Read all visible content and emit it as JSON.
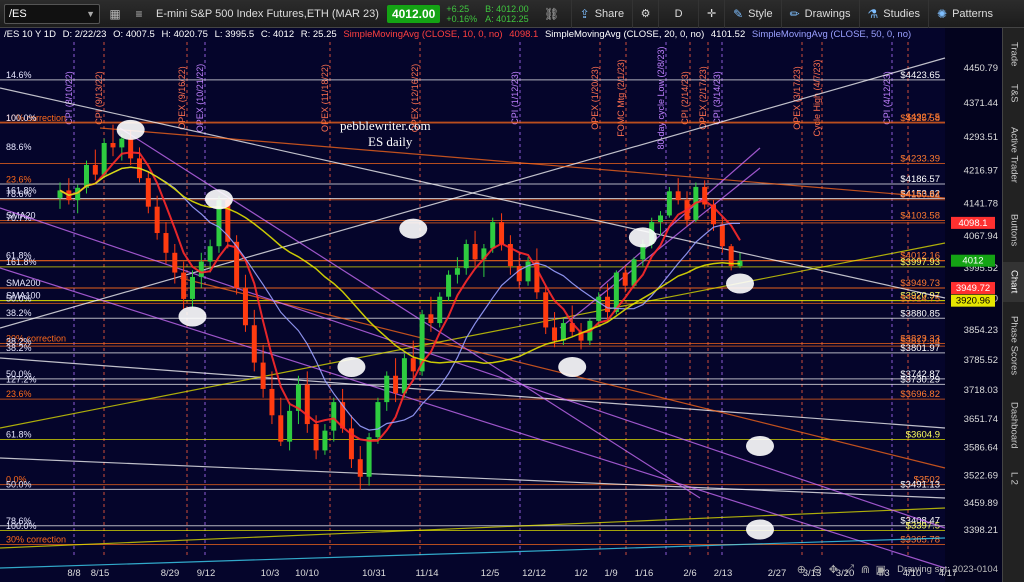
{
  "toolbar": {
    "symbol": "/ES",
    "instrument_name": "E-mini S&P 500 Index Futures,ETH (MAR 23)",
    "last_price": "4012.00",
    "net_change": "+6.25",
    "pct_change": "+0.16%",
    "bid": "B: 4012.00",
    "ask": "A: 4012.25",
    "share_label": "Share",
    "aggregation_label": "D",
    "style_label": "Style",
    "drawings_label": "Drawings",
    "studies_label": "Studies",
    "patterns_label": "Patterns",
    "icons": [
      "chevron-down-icon",
      "grid-icon",
      "menu-icon",
      "link-icon",
      "share-icon",
      "settings-icon",
      "crosshair-icon",
      "pencil-icon",
      "flask-icon",
      "patterns-icon"
    ]
  },
  "studies": {
    "header": "/ES 10 Y 1D",
    "date": "D: 2/22/23",
    "open": "O: 4007.5",
    "high": "H: 4020.75",
    "low": "L: 3995.5",
    "close": "C: 4012",
    "range": "R: 25.25",
    "sma10": "SimpleMovingAvg (CLOSE, 10, 0, no)",
    "sma10_val": "4098.1",
    "sma20": "SimpleMovingAvg (CLOSE, 20, 0, no)",
    "sma20_val": "4101.52",
    "sma50": "SimpleMovingAvg (CLOSE, 50, 0, no)"
  },
  "watermark": {
    "line1": "pebblewriter.com",
    "line2": "ES daily"
  },
  "side_tabs": [
    "Trade",
    "T&S",
    "Active Trader",
    "Buttons",
    "Chart",
    "Phase Scores",
    "Dashboard",
    "L 2"
  ],
  "active_side_tab": "Chart",
  "footer": {
    "drawing_set": "Drawing set: 2023-0104",
    "icons": [
      "zoom-in-icon",
      "zoom-out-icon",
      "pan-icon",
      "expand-icon",
      "magnet-icon",
      "scroll-icon",
      "lock-icon"
    ]
  },
  "colors": {
    "background": "#05052b",
    "up_candle": "#2ecc40",
    "down_candle": "#ff3b10",
    "sma10": "#ff2a2a",
    "sma20": "#9aa0ff",
    "sma50": "#e0e000",
    "fib_white": "#ffffff",
    "fib_orange": "#ff6a1a",
    "trend_magenta": "#d070ff",
    "last_price_bg": "#14a314"
  },
  "chart_data": {
    "type": "candlestick",
    "symbol": "/ES",
    "ylim": [
      3335,
      4510
    ],
    "x_ticks": [
      "8/8",
      "8/15",
      "8/29",
      "9/12",
      "10/3",
      "10/10",
      "10/31",
      "11/14",
      "12/5",
      "12/12",
      "1/2",
      "1/9",
      "1/16",
      "2/6",
      "2/13",
      "2/27",
      "3/13",
      "3/20",
      "4/3",
      "4/10",
      "4/17"
    ],
    "y_ticks": [
      4450.79,
      4371.44,
      4293.51,
      4216.97,
      4141.78,
      4067.94,
      3995.52,
      3925.8,
      3854.23,
      3785.52,
      3718.03,
      3651.74,
      3586.64,
      3522.69,
      3459.89,
      3398.21
    ],
    "price_labels": [
      {
        "value": 4423.65,
        "text": "$4423.65"
      },
      {
        "value": 4327.5,
        "text": "$4327.5"
      },
      {
        "value": 4325.58,
        "text": "$4325.58"
      },
      {
        "value": 4233.39,
        "text": "$4233.39"
      },
      {
        "value": 4186.57,
        "text": "$4186.57"
      },
      {
        "value": 4153.62,
        "text": "$4153.62"
      },
      {
        "value": 4150.84,
        "text": "$4150.84"
      },
      {
        "value": 4103.58,
        "text": "$4103.58"
      },
      {
        "value": 4098.1,
        "text": "4098.1"
      },
      {
        "value": 4012.16,
        "text": "$4012.16"
      },
      {
        "value": 3997.93,
        "text": "$3997.93"
      },
      {
        "value": 4012,
        "text": "4012"
      },
      {
        "value": 3949.73,
        "text": "$3949.73"
      },
      {
        "value": 3949.72,
        "text": "3949.72"
      },
      {
        "value": 3920.97,
        "text": "$3920.97"
      },
      {
        "value": 3920.96,
        "text": "3920.96"
      },
      {
        "value": 3914.75,
        "text": "$3914.75"
      },
      {
        "value": 3880.85,
        "text": "$3880.85"
      },
      {
        "value": 3823.33,
        "text": "$3823.33"
      },
      {
        "value": 3817.34,
        "text": "$3817.34"
      },
      {
        "value": 3801.97,
        "text": "$3801.97"
      },
      {
        "value": 3742.87,
        "text": "$3742.87"
      },
      {
        "value": 3730.29,
        "text": "$3730.29"
      },
      {
        "value": 3696.82,
        "text": "$3696.82"
      },
      {
        "value": 3604.9,
        "text": "$3604.9"
      },
      {
        "value": 3502,
        "text": "$3502"
      },
      {
        "value": 3491.13,
        "text": "$3491.13"
      },
      {
        "value": 3408.47,
        "text": "$3408.47"
      },
      {
        "value": 3397.5,
        "text": "$3397.5"
      },
      {
        "value": 3365.78,
        "text": "$3365.78"
      }
    ],
    "fib_labels": [
      {
        "text": "14.6%",
        "value": 4423
      },
      {
        "text": "10% correction",
        "value": 4325
      },
      {
        "text": "100.0%",
        "value": 4325
      },
      {
        "text": "88.6%",
        "value": 4260
      },
      {
        "text": "23.6%",
        "value": 4186
      },
      {
        "text": "161.8%",
        "value": 4160
      },
      {
        "text": "78.6%",
        "value": 4153
      },
      {
        "text": "SMA20",
        "value": 4104
      },
      {
        "text": "70.7%",
        "value": 4098
      },
      {
        "text": "61.8%",
        "value": 4012
      },
      {
        "text": "161.8%",
        "value": 3998
      },
      {
        "text": "SMA200",
        "value": 3950
      },
      {
        "text": "SMA100",
        "value": 3921
      },
      {
        "text": "50.0%",
        "value": 3915
      },
      {
        "text": "38.2%",
        "value": 3881
      },
      {
        "text": "20% correction",
        "value": 3823
      },
      {
        "text": "38.2%",
        "value": 3817
      },
      {
        "text": "38.2%",
        "value": 3802
      },
      {
        "text": "50.0%",
        "value": 3743
      },
      {
        "text": "127.2%",
        "value": 3730
      },
      {
        "text": "23.6%",
        "value": 3697
      },
      {
        "text": "61.8%",
        "value": 3605
      },
      {
        "text": "0.0%",
        "value": 3502
      },
      {
        "text": "50.0%",
        "value": 3491
      },
      {
        "text": "78.6%",
        "value": 3408
      },
      {
        "text": "100.0%",
        "value": 3397
      },
      {
        "text": "30% correction",
        "value": 3366
      }
    ],
    "event_labels": [
      {
        "text": "CPI (8/10/22)",
        "date": "8/10"
      },
      {
        "text": "CPI (9/13/22)",
        "date": "9/13"
      },
      {
        "text": "OPEX (9/16/22)",
        "date": "9/16"
      },
      {
        "text": "OPEX (10/21/22)",
        "date": "10/21"
      },
      {
        "text": "OPEX (11/18/22)",
        "date": "11/18"
      },
      {
        "text": "OPEX (12/16/22)",
        "date": "12/16"
      },
      {
        "text": "CPI (1/12/23)",
        "date": "1/12"
      },
      {
        "text": "OPEX (1/20/23)",
        "date": "1/20"
      },
      {
        "text": "FOMC Mtg (2/1/23)",
        "date": "2/1"
      },
      {
        "text": "80-day cycle Low (2/8/23)",
        "date": "2/8"
      },
      {
        "text": "CPI (2/14/23)",
        "date": "2/14"
      },
      {
        "text": "OPEX (2/17/23)",
        "date": "2/17"
      },
      {
        "text": "CPI (3/14/23)",
        "date": "3/14"
      },
      {
        "text": "OPEX (3/17/23)",
        "date": "3/17"
      },
      {
        "text": "Cycle High (4/7/23)",
        "date": "4/7"
      },
      {
        "text": "CPI (4/12/23)",
        "date": "4/12"
      }
    ],
    "candles": [
      [
        4155,
        4190,
        4130,
        4172
      ],
      [
        4172,
        4200,
        4140,
        4150
      ],
      [
        4150,
        4185,
        4120,
        4178
      ],
      [
        4178,
        4240,
        4165,
        4230
      ],
      [
        4230,
        4265,
        4195,
        4208
      ],
      [
        4208,
        4290,
        4200,
        4280
      ],
      [
        4280,
        4322,
        4250,
        4270
      ],
      [
        4270,
        4300,
        4240,
        4290
      ],
      [
        4290,
        4310,
        4230,
        4245
      ],
      [
        4245,
        4270,
        4190,
        4200
      ],
      [
        4200,
        4215,
        4120,
        4135
      ],
      [
        4135,
        4160,
        4060,
        4075
      ],
      [
        4075,
        4100,
        4005,
        4030
      ],
      [
        4030,
        4050,
        3960,
        3985
      ],
      [
        3985,
        4010,
        3900,
        3925
      ],
      [
        3925,
        3990,
        3905,
        3975
      ],
      [
        3975,
        4030,
        3950,
        4010
      ],
      [
        4010,
        4060,
        3985,
        4045
      ],
      [
        4045,
        4160,
        4030,
        4150
      ],
      [
        4150,
        4155,
        4040,
        4055
      ],
      [
        4055,
        4070,
        3935,
        3950
      ],
      [
        3950,
        3980,
        3850,
        3865
      ],
      [
        3865,
        3900,
        3760,
        3780
      ],
      [
        3780,
        3820,
        3700,
        3720
      ],
      [
        3720,
        3760,
        3640,
        3660
      ],
      [
        3660,
        3700,
        3590,
        3600
      ],
      [
        3600,
        3690,
        3580,
        3670
      ],
      [
        3670,
        3750,
        3640,
        3730
      ],
      [
        3730,
        3760,
        3620,
        3640
      ],
      [
        3640,
        3660,
        3560,
        3580
      ],
      [
        3580,
        3640,
        3570,
        3625
      ],
      [
        3625,
        3700,
        3600,
        3690
      ],
      [
        3690,
        3720,
        3620,
        3630
      ],
      [
        3630,
        3660,
        3540,
        3560
      ],
      [
        3560,
        3590,
        3490,
        3520
      ],
      [
        3520,
        3620,
        3500,
        3610
      ],
      [
        3610,
        3700,
        3595,
        3690
      ],
      [
        3690,
        3760,
        3670,
        3750
      ],
      [
        3750,
        3790,
        3690,
        3710
      ],
      [
        3710,
        3800,
        3700,
        3790
      ],
      [
        3790,
        3830,
        3740,
        3760
      ],
      [
        3760,
        3900,
        3750,
        3890
      ],
      [
        3890,
        3930,
        3850,
        3870
      ],
      [
        3870,
        3940,
        3860,
        3930
      ],
      [
        3930,
        3990,
        3920,
        3980
      ],
      [
        3980,
        4020,
        3960,
        3995
      ],
      [
        3995,
        4060,
        3980,
        4050
      ],
      [
        4050,
        4080,
        4000,
        4015
      ],
      [
        4015,
        4050,
        3975,
        4040
      ],
      [
        4040,
        4110,
        4030,
        4100
      ],
      [
        4100,
        4120,
        4035,
        4050
      ],
      [
        4050,
        4070,
        3980,
        4000
      ],
      [
        4000,
        4030,
        3950,
        3965
      ],
      [
        3965,
        4020,
        3955,
        4010
      ],
      [
        4010,
        4040,
        3925,
        3940
      ],
      [
        3940,
        3955,
        3845,
        3860
      ],
      [
        3860,
        3895,
        3815,
        3830
      ],
      [
        3830,
        3880,
        3820,
        3870
      ],
      [
        3870,
        3910,
        3840,
        3850
      ],
      [
        3850,
        3870,
        3810,
        3830
      ],
      [
        3830,
        3880,
        3820,
        3875
      ],
      [
        3875,
        3940,
        3865,
        3930
      ],
      [
        3930,
        3960,
        3880,
        3895
      ],
      [
        3895,
        3990,
        3890,
        3985
      ],
      [
        3985,
        4000,
        3940,
        3955
      ],
      [
        3955,
        4020,
        3950,
        4015
      ],
      [
        4015,
        4060,
        4000,
        4050
      ],
      [
        4050,
        4110,
        4040,
        4100
      ],
      [
        4100,
        4125,
        4070,
        4115
      ],
      [
        4115,
        4180,
        4110,
        4170
      ],
      [
        4170,
        4200,
        4140,
        4150
      ],
      [
        4150,
        4170,
        4090,
        4105
      ],
      [
        4105,
        4190,
        4100,
        4180
      ],
      [
        4180,
        4195,
        4130,
        4140
      ],
      [
        4140,
        4150,
        4080,
        4095
      ],
      [
        4095,
        4110,
        4030,
        4045
      ],
      [
        4045,
        4050,
        3990,
        4000
      ],
      [
        4000,
        4030,
        3995,
        4012
      ]
    ],
    "highlight_ellipses": [
      {
        "idx": 8,
        "value": 4310
      },
      {
        "idx": 18,
        "value": 4152
      },
      {
        "idx": 15,
        "value": 3885
      },
      {
        "idx": 40,
        "value": 4085
      },
      {
        "idx": 33,
        "value": 3770
      },
      {
        "idx": 58,
        "value": 3770
      },
      {
        "idx": 66,
        "value": 4065
      },
      {
        "idx": 77,
        "value": 3960
      },
      {
        "idx": 93,
        "value": 3590
      },
      {
        "idx": 87,
        "value": 3400
      }
    ]
  }
}
